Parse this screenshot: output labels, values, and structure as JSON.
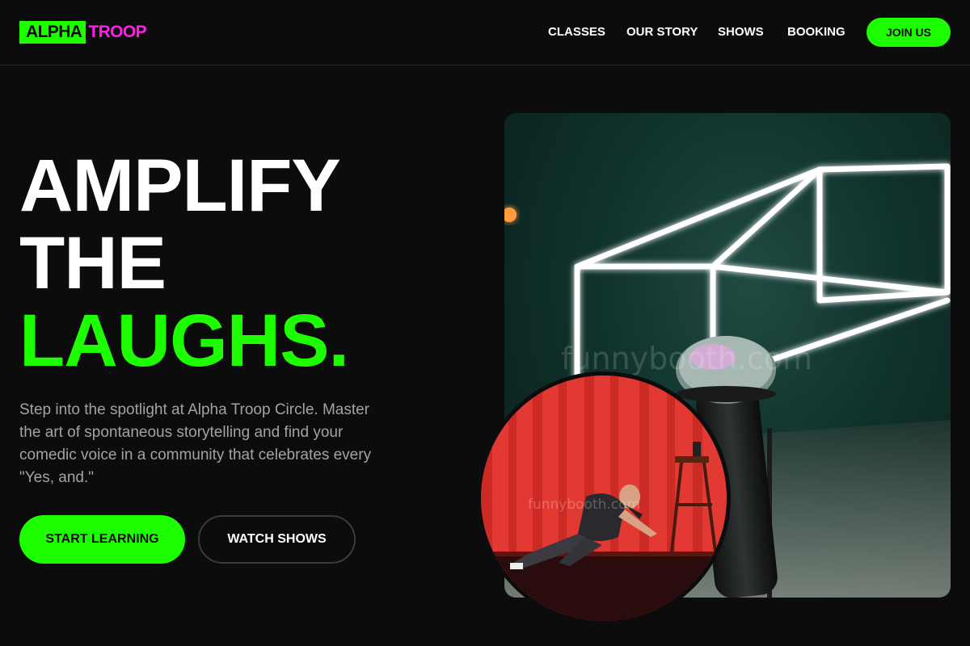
{
  "header": {
    "logo_part1": "ALPHA",
    "logo_part2": "TROOP",
    "nav": [
      "CLASSES",
      "OUR STORY",
      "SHOWS",
      "BOOKING"
    ],
    "join_label": "JOIN US"
  },
  "hero": {
    "headline_line1": "AMPLIFY",
    "headline_line2": "THE",
    "headline_line3": "LAUGHS.",
    "subtext": "Step into the spotlight at Alpha Troop Circle. Master the art of spontaneous storytelling and find your comedic voice in a community that celebrates every \"Yes, and.\"",
    "primary_button": "START LEARNING",
    "secondary_button": "WATCH SHOWS",
    "image_watermark": "funnybooth.com",
    "circle_watermark": "funnybooth.com"
  },
  "colors": {
    "background": "#0c0c0c",
    "accent_green": "#1dff00",
    "accent_magenta": "#ff1fe6",
    "muted_text": "#a3a3a3"
  }
}
